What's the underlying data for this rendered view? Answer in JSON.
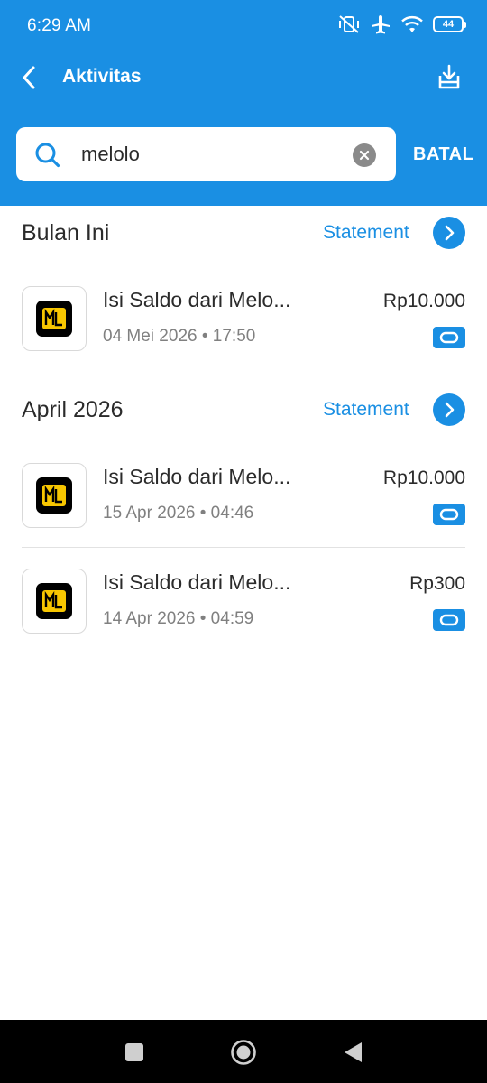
{
  "status_bar": {
    "time": "6:29 AM",
    "battery": "44",
    "icons": [
      "vibrate-off-icon",
      "airplane-icon",
      "wifi-icon",
      "battery-icon"
    ]
  },
  "header": {
    "title": "Aktivitas",
    "back_icon": "chevron-left-icon",
    "download_icon": "download-icon"
  },
  "search": {
    "value": "melolo",
    "placeholder": "",
    "cancel_label": "BATAL"
  },
  "sections": [
    {
      "title": "Bulan Ini",
      "statement_label": "Statement",
      "transactions": [
        {
          "name": "Isi Saldo dari Melo...",
          "date": "04 Mei 2026 • 17:50",
          "amount": "Rp10.000"
        }
      ]
    },
    {
      "title": "April 2026",
      "statement_label": "Statement",
      "transactions": [
        {
          "name": "Isi Saldo dari Melo...",
          "date": "15 Apr 2026 • 04:46",
          "amount": "Rp10.000"
        },
        {
          "name": "Isi Saldo dari Melo...",
          "date": "14 Apr 2026 • 04:59",
          "amount": "Rp300"
        }
      ]
    }
  ],
  "colors": {
    "primary": "#1a8fe3",
    "logo_yellow": "#f7c600",
    "text": "#2b2b2b",
    "muted": "#808080"
  },
  "nav": [
    "recent-apps-icon",
    "home-icon",
    "back-triangle-icon"
  ]
}
